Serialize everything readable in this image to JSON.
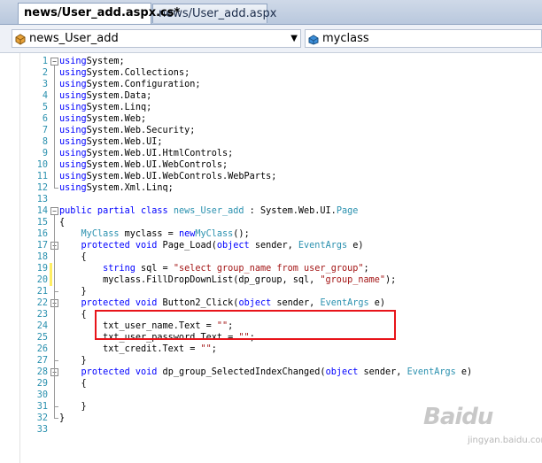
{
  "tabs": [
    {
      "label": "news/User_add.aspx.cs*",
      "active": true
    },
    {
      "label": "news/User_add.aspx",
      "active": false
    }
  ],
  "navigation": {
    "type_dropdown": {
      "value": "news_User_add",
      "icon": "class-icon"
    },
    "member_dropdown": {
      "value": "myclass",
      "icon": "field-icon"
    }
  },
  "code_lines": [
    {
      "n": "1",
      "tokens": [
        [
          "kw",
          "using"
        ],
        [
          "",
          "System;"
        ]
      ]
    },
    {
      "n": "2",
      "tokens": [
        [
          "kw",
          "using"
        ],
        [
          "",
          "System.Collections;"
        ]
      ]
    },
    {
      "n": "3",
      "tokens": [
        [
          "kw",
          "using"
        ],
        [
          "",
          "System.Configuration;"
        ]
      ]
    },
    {
      "n": "4",
      "tokens": [
        [
          "kw",
          "using"
        ],
        [
          "",
          "System.Data;"
        ]
      ]
    },
    {
      "n": "5",
      "tokens": [
        [
          "kw",
          "using"
        ],
        [
          "",
          "System.Linq;"
        ]
      ]
    },
    {
      "n": "6",
      "tokens": [
        [
          "kw",
          "using"
        ],
        [
          "",
          "System.Web;"
        ]
      ]
    },
    {
      "n": "7",
      "tokens": [
        [
          "kw",
          "using"
        ],
        [
          "",
          "System.Web.Security;"
        ]
      ]
    },
    {
      "n": "8",
      "tokens": [
        [
          "kw",
          "using"
        ],
        [
          "",
          "System.Web.UI;"
        ]
      ]
    },
    {
      "n": "9",
      "tokens": [
        [
          "kw",
          "using"
        ],
        [
          "",
          "System.Web.UI.HtmlControls;"
        ]
      ]
    },
    {
      "n": "10",
      "tokens": [
        [
          "kw",
          "using"
        ],
        [
          "",
          "System.Web.UI.WebControls;"
        ]
      ]
    },
    {
      "n": "11",
      "tokens": [
        [
          "kw",
          "using"
        ],
        [
          "",
          "System.Web.UI.WebControls.WebParts;"
        ]
      ]
    },
    {
      "n": "12",
      "tokens": [
        [
          "kw",
          "using"
        ],
        [
          "",
          "System.Xml.Linq;"
        ]
      ]
    },
    {
      "n": "13",
      "tokens": []
    },
    {
      "n": "14",
      "tokens": [
        [
          "kw",
          "public partial class"
        ],
        [
          "ty",
          "news_User_add"
        ],
        [
          "",
          " : System.Web.UI."
        ],
        [
          "ty",
          "Page"
        ]
      ]
    },
    {
      "n": "15",
      "tokens": [
        [
          "",
          "{"
        ]
      ]
    },
    {
      "n": "16",
      "tokens": [
        [
          "",
          "    "
        ],
        [
          "ty",
          "MyClass"
        ],
        [
          "",
          " myclass = "
        ],
        [
          "kw",
          "new"
        ],
        [
          " ",
          ""
        ],
        [
          "ty",
          "MyClass"
        ],
        [
          "",
          "();"
        ]
      ]
    },
    {
      "n": "17",
      "tokens": [
        [
          "",
          "    "
        ],
        [
          "kw",
          "protected void"
        ],
        [
          "",
          " Page_Load("
        ],
        [
          "kw",
          "object"
        ],
        [
          "",
          " sender, "
        ],
        [
          "ty",
          "EventArgs"
        ],
        [
          "",
          " e)"
        ]
      ]
    },
    {
      "n": "18",
      "tokens": [
        [
          "",
          "    {"
        ]
      ]
    },
    {
      "n": "19",
      "tokens": [
        [
          "",
          "        "
        ],
        [
          "kw",
          "string"
        ],
        [
          "",
          " sql = "
        ],
        [
          "st",
          "\"select group_name from user_group\""
        ],
        [
          "",
          ";"
        ]
      ]
    },
    {
      "n": "20",
      "tokens": [
        [
          "",
          "        myclass.FillDropDownList(dp_group, sql, "
        ],
        [
          "st",
          "\"group_name\""
        ],
        [
          "",
          ");"
        ]
      ]
    },
    {
      "n": "21",
      "tokens": [
        [
          "",
          "    }"
        ]
      ]
    },
    {
      "n": "22",
      "tokens": [
        [
          "",
          "    "
        ],
        [
          "kw",
          "protected void"
        ],
        [
          "",
          " Button2_Click("
        ],
        [
          "kw",
          "object"
        ],
        [
          "",
          " sender, "
        ],
        [
          "ty",
          "EventArgs"
        ],
        [
          "",
          " e)"
        ]
      ]
    },
    {
      "n": "23",
      "tokens": [
        [
          "",
          "    {"
        ]
      ]
    },
    {
      "n": "24",
      "tokens": [
        [
          "",
          "        txt_user_name.Text = "
        ],
        [
          "st",
          "\"\""
        ],
        [
          "",
          ";"
        ]
      ]
    },
    {
      "n": "25",
      "tokens": [
        [
          "",
          "        txt_user_password.Text = "
        ],
        [
          "st",
          "\"\""
        ],
        [
          "",
          ";"
        ]
      ]
    },
    {
      "n": "26",
      "tokens": [
        [
          "",
          "        txt_credit.Text = "
        ],
        [
          "st",
          "\"\""
        ],
        [
          "",
          ";"
        ]
      ]
    },
    {
      "n": "27",
      "tokens": [
        [
          "",
          "    }"
        ]
      ]
    },
    {
      "n": "28",
      "tokens": [
        [
          "",
          "    "
        ],
        [
          "kw",
          "protected void"
        ],
        [
          "",
          " dp_group_SelectedIndexChanged("
        ],
        [
          "kw",
          "object"
        ],
        [
          "",
          " sender, "
        ],
        [
          "ty",
          "EventArgs"
        ],
        [
          "",
          " e)"
        ]
      ]
    },
    {
      "n": "29",
      "tokens": [
        [
          "",
          "    {"
        ]
      ]
    },
    {
      "n": "30",
      "tokens": []
    },
    {
      "n": "31",
      "tokens": [
        [
          "",
          "    }"
        ]
      ]
    },
    {
      "n": "32",
      "tokens": [
        [
          "",
          "}"
        ]
      ]
    },
    {
      "n": "33",
      "tokens": []
    }
  ],
  "changed_lines": [
    "19",
    "20"
  ],
  "fold_markers": [
    "1",
    "14",
    "17",
    "22",
    "28"
  ],
  "highlight": {
    "color": "#e8141a",
    "lines": [
      "19",
      "20"
    ]
  },
  "watermark": {
    "brand": "Baidu",
    "sub": "jingyan.baidu.com"
  },
  "colors": {
    "keyword": "#0000ff",
    "type": "#2b91af",
    "string": "#a31515",
    "line_number": "#2b91af"
  }
}
